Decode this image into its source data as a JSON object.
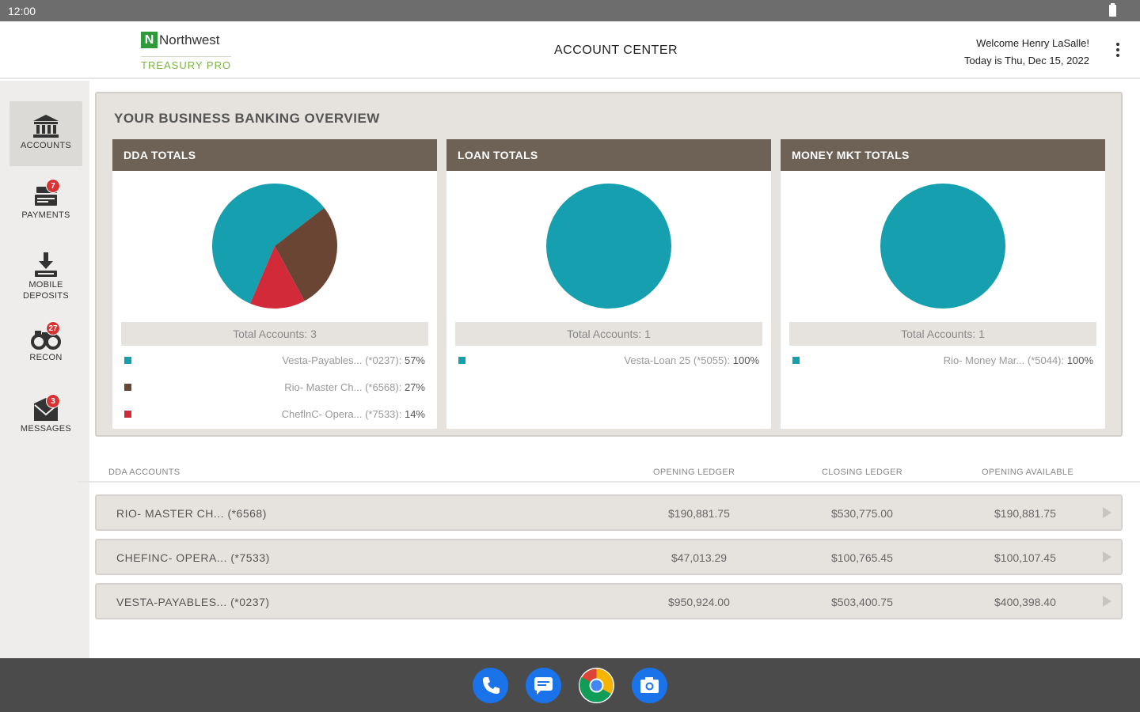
{
  "status_bar": {
    "time": "12:00"
  },
  "header": {
    "logo_mark": "N",
    "brand": "Northwest",
    "brand_sub": "TREASURY PRO",
    "title": "ACCOUNT CENTER",
    "welcome": "Welcome Henry LaSalle!",
    "date": "Today is Thu, Dec 15, 2022"
  },
  "sidebar": {
    "items": [
      {
        "label": "ACCOUNTS",
        "icon": "bank-icon",
        "badge": ""
      },
      {
        "label": "PAYMENTS",
        "icon": "payments-icon",
        "badge": "7"
      },
      {
        "label_line1": "MOBILE",
        "label_line2": "DEPOSITS",
        "icon": "download-icon"
      },
      {
        "label": "RECON",
        "icon": "binoculars-icon",
        "badge": "27"
      },
      {
        "label": "MESSAGES",
        "icon": "envelope-icon",
        "badge": "3"
      }
    ]
  },
  "overview": {
    "title": "YOUR BUSINESS BANKING OVERVIEW",
    "cards": [
      {
        "title": "DDA TOTALS",
        "total": "Total Accounts: 3",
        "legend": [
          {
            "label": "Vesta-Payables... (*0237):",
            "pct": "57%",
            "color": "#169fae"
          },
          {
            "label": "Rio- Master Ch... (*6568):",
            "pct": "27%",
            "color": "#6b4534"
          },
          {
            "label": "CheflnC- Opera... (*7533):",
            "pct": "14%",
            "color": "#d32a3a"
          }
        ]
      },
      {
        "title": "LOAN TOTALS",
        "total": "Total Accounts: 1",
        "legend": [
          {
            "label": "Vesta-Loan 25 (*5055):",
            "pct": "100%",
            "color": "#169fae"
          }
        ]
      },
      {
        "title": "MONEY MKT TOTALS",
        "total": "Total Accounts: 1",
        "legend": [
          {
            "label": "Rio- Money Mar... (*5044):",
            "pct": "100%",
            "color": "#169fae"
          }
        ]
      }
    ]
  },
  "chart_data": [
    {
      "type": "pie",
      "categories": [
        "Vesta-Payables... (*0237)",
        "Rio- Master Ch... (*6568)",
        "CheflnC- Opera... (*7533)"
      ],
      "values": [
        57,
        27,
        14
      ],
      "colors": [
        "#169fae",
        "#6b4534",
        "#d32a3a"
      ]
    },
    {
      "type": "pie",
      "categories": [
        "Vesta-Loan 25 (*5055)"
      ],
      "values": [
        100
      ],
      "colors": [
        "#169fae"
      ]
    },
    {
      "type": "pie",
      "categories": [
        "Rio- Money Mar... (*5044)"
      ],
      "values": [
        100
      ],
      "colors": [
        "#169fae"
      ]
    }
  ],
  "accounts_table": {
    "headers": [
      "DDA ACCOUNTS",
      "OPENING LEDGER",
      "CLOSING LEDGER",
      "OPENING AVAILABLE"
    ],
    "rows": [
      {
        "name": "RIO- MASTER CH... (*6568)",
        "opening_ledger": "$190,881.75",
        "closing_ledger": "$530,775.00",
        "opening_available": "$190,881.75"
      },
      {
        "name": "CHEFINC- OPERA... (*7533)",
        "opening_ledger": "$47,013.29",
        "closing_ledger": "$100,765.45",
        "opening_available": "$100,107.45"
      },
      {
        "name": "VESTA-PAYABLES... (*0237)",
        "opening_ledger": "$950,924.00",
        "closing_ledger": "$503,400.75",
        "opening_available": "$400,398.40"
      }
    ]
  },
  "dock": [
    {
      "icon": "phone-icon",
      "color": "#1a73e8"
    },
    {
      "icon": "messages-icon",
      "color": "#1a73e8"
    },
    {
      "icon": "chrome-icon",
      "color": "#ffffff"
    },
    {
      "icon": "camera-icon",
      "color": "#1a73e8"
    }
  ]
}
